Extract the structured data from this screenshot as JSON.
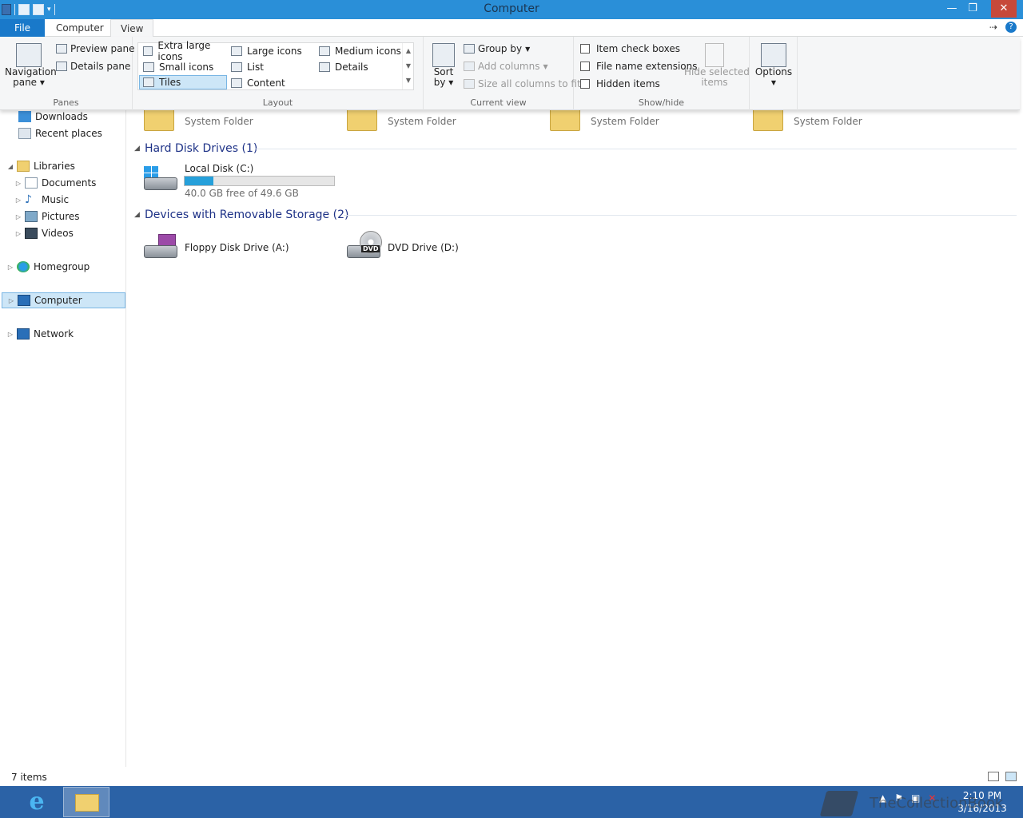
{
  "window": {
    "title": "Computer"
  },
  "tabs": {
    "file": "File",
    "computer": "Computer",
    "view": "View"
  },
  "ribbon": {
    "panes": {
      "label": "Panes",
      "navigation_pane": "Navigation",
      "navigation_pane_line2": "pane",
      "preview_pane": "Preview pane",
      "details_pane": "Details pane"
    },
    "layout": {
      "label": "Layout",
      "items": [
        "Extra large icons",
        "Large icons",
        "Medium icons",
        "Small icons",
        "List",
        "Details",
        "Tiles",
        "Content"
      ],
      "selected": "Tiles"
    },
    "current_view": {
      "label": "Current view",
      "sort_by": "Sort",
      "sort_by_line2": "by",
      "group_by": "Group by",
      "add_columns": "Add columns",
      "size_all_columns": "Size all columns to fit"
    },
    "show_hide": {
      "label": "Show/hide",
      "item_check_boxes": "Item check boxes",
      "file_name_extensions": "File name extensions",
      "hidden_items": "Hidden items",
      "hide_selected_items": "Hide selected",
      "hide_selected_items_line2": "items"
    },
    "options": {
      "label": "Options"
    }
  },
  "nav": {
    "downloads": "Downloads",
    "recent_places": "Recent places",
    "libraries": "Libraries",
    "documents": "Documents",
    "music": "Music",
    "pictures": "Pictures",
    "videos": "Videos",
    "homegroup": "Homegroup",
    "computer": "Computer",
    "network": "Network"
  },
  "content": {
    "folders": [
      {
        "subtitle": "System Folder"
      },
      {
        "subtitle": "System Folder"
      },
      {
        "subtitle": "System Folder"
      },
      {
        "subtitle": "System Folder"
      }
    ],
    "hard_disk_group": "Hard Disk Drives (1)",
    "local_disk": {
      "name": "Local Disk (C:)",
      "free_text": "40.0 GB free of 49.6 GB",
      "used_fraction": 0.19
    },
    "removable_group": "Devices with Removable Storage (2)",
    "floppy": {
      "name": "Floppy Disk Drive (A:)"
    },
    "dvd": {
      "name": "DVD Drive (D:)",
      "badge": "DVD"
    }
  },
  "status": {
    "count": "7 items"
  },
  "taskbar": {
    "time": "2:10 PM",
    "date": "3/16/2013"
  },
  "watermark": {
    "text": "TheCollectionBook"
  },
  "colors": {
    "titlebar": "#2a8fd8",
    "file_tab": "#1979ca",
    "taskbar": "#2b62a6",
    "progress": "#26a0da",
    "selection": "#cde6f7"
  }
}
